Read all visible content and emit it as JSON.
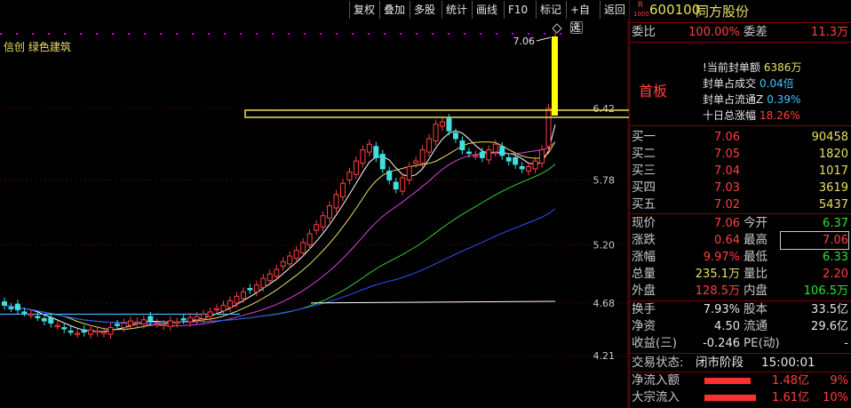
{
  "toolbar": {
    "items": [
      "复权",
      "叠加",
      "多股",
      "统计",
      "画线",
      "F10",
      "标记",
      "+自选",
      "返回"
    ]
  },
  "stock_tags": "信创 绿色建筑",
  "chart": {
    "price_ticks": [
      "6.42",
      "5.78",
      "5.20",
      "4.68",
      "4.21"
    ],
    "last_close_label": "7.06"
  },
  "header": {
    "badge_top": "R",
    "badge_bottom": "1000",
    "code": "600100",
    "name": "同方股份"
  },
  "weibi": {
    "label1": "委比",
    "value1": "100.00%",
    "label2": "委差",
    "value2": "11.3万"
  },
  "seal": {
    "tag": "首板",
    "lines": [
      {
        "label": "当前封单额",
        "value": "6386万"
      },
      {
        "label": "封单占成交",
        "value": "0.04倍"
      },
      {
        "label": "封单占流通Z",
        "value": "0.39%"
      },
      {
        "label": "十日总涨幅",
        "value": "18.26%"
      }
    ]
  },
  "bids": [
    {
      "label": "买一",
      "price": "7.06",
      "vol": "90458"
    },
    {
      "label": "买二",
      "price": "7.05",
      "vol": "1820"
    },
    {
      "label": "买三",
      "price": "7.04",
      "vol": "1017"
    },
    {
      "label": "买四",
      "price": "7.03",
      "vol": "3619"
    },
    {
      "label": "买五",
      "price": "7.02",
      "vol": "5437"
    }
  ],
  "quote": [
    {
      "l1": "现价",
      "v1": "7.06",
      "l2": "今开",
      "v2": "6.37"
    },
    {
      "l1": "涨跌",
      "v1": "0.64",
      "l2": "最高",
      "v2": "7.06"
    },
    {
      "l1": "涨幅",
      "v1": "9.97%",
      "l2": "最低",
      "v2": "6.33"
    },
    {
      "l1": "总量",
      "v1": "235.1万",
      "l2": "量比",
      "v2": "2.20"
    },
    {
      "l1": "外盘",
      "v1": "128.5万",
      "l2": "内盘",
      "v2": "106.5万"
    }
  ],
  "fund": [
    {
      "l1": "换手",
      "v1": "7.93%",
      "l2": "股本",
      "v2": "33.5亿"
    },
    {
      "l1": "净资",
      "v1": "4.50",
      "l2": "流通",
      "v2": "29.6亿"
    },
    {
      "l1": "收益(三)",
      "v1": "-0.246",
      "l2": "PE(动)",
      "v2": "-"
    }
  ],
  "status": {
    "label": "交易状态:",
    "value": "闭市阶段",
    "time": "15:00:01"
  },
  "flows": [
    {
      "label": "净流入额",
      "value": "1.48亿",
      "pct": "9%",
      "ratio": 0.9
    },
    {
      "label": "大宗流入",
      "value": "1.61亿",
      "pct": "10%",
      "ratio": 1.0
    }
  ],
  "colors": {
    "up": "#ff4040",
    "down": "#40e0e0",
    "accent": "#e8e060",
    "bg": "#000000"
  }
}
